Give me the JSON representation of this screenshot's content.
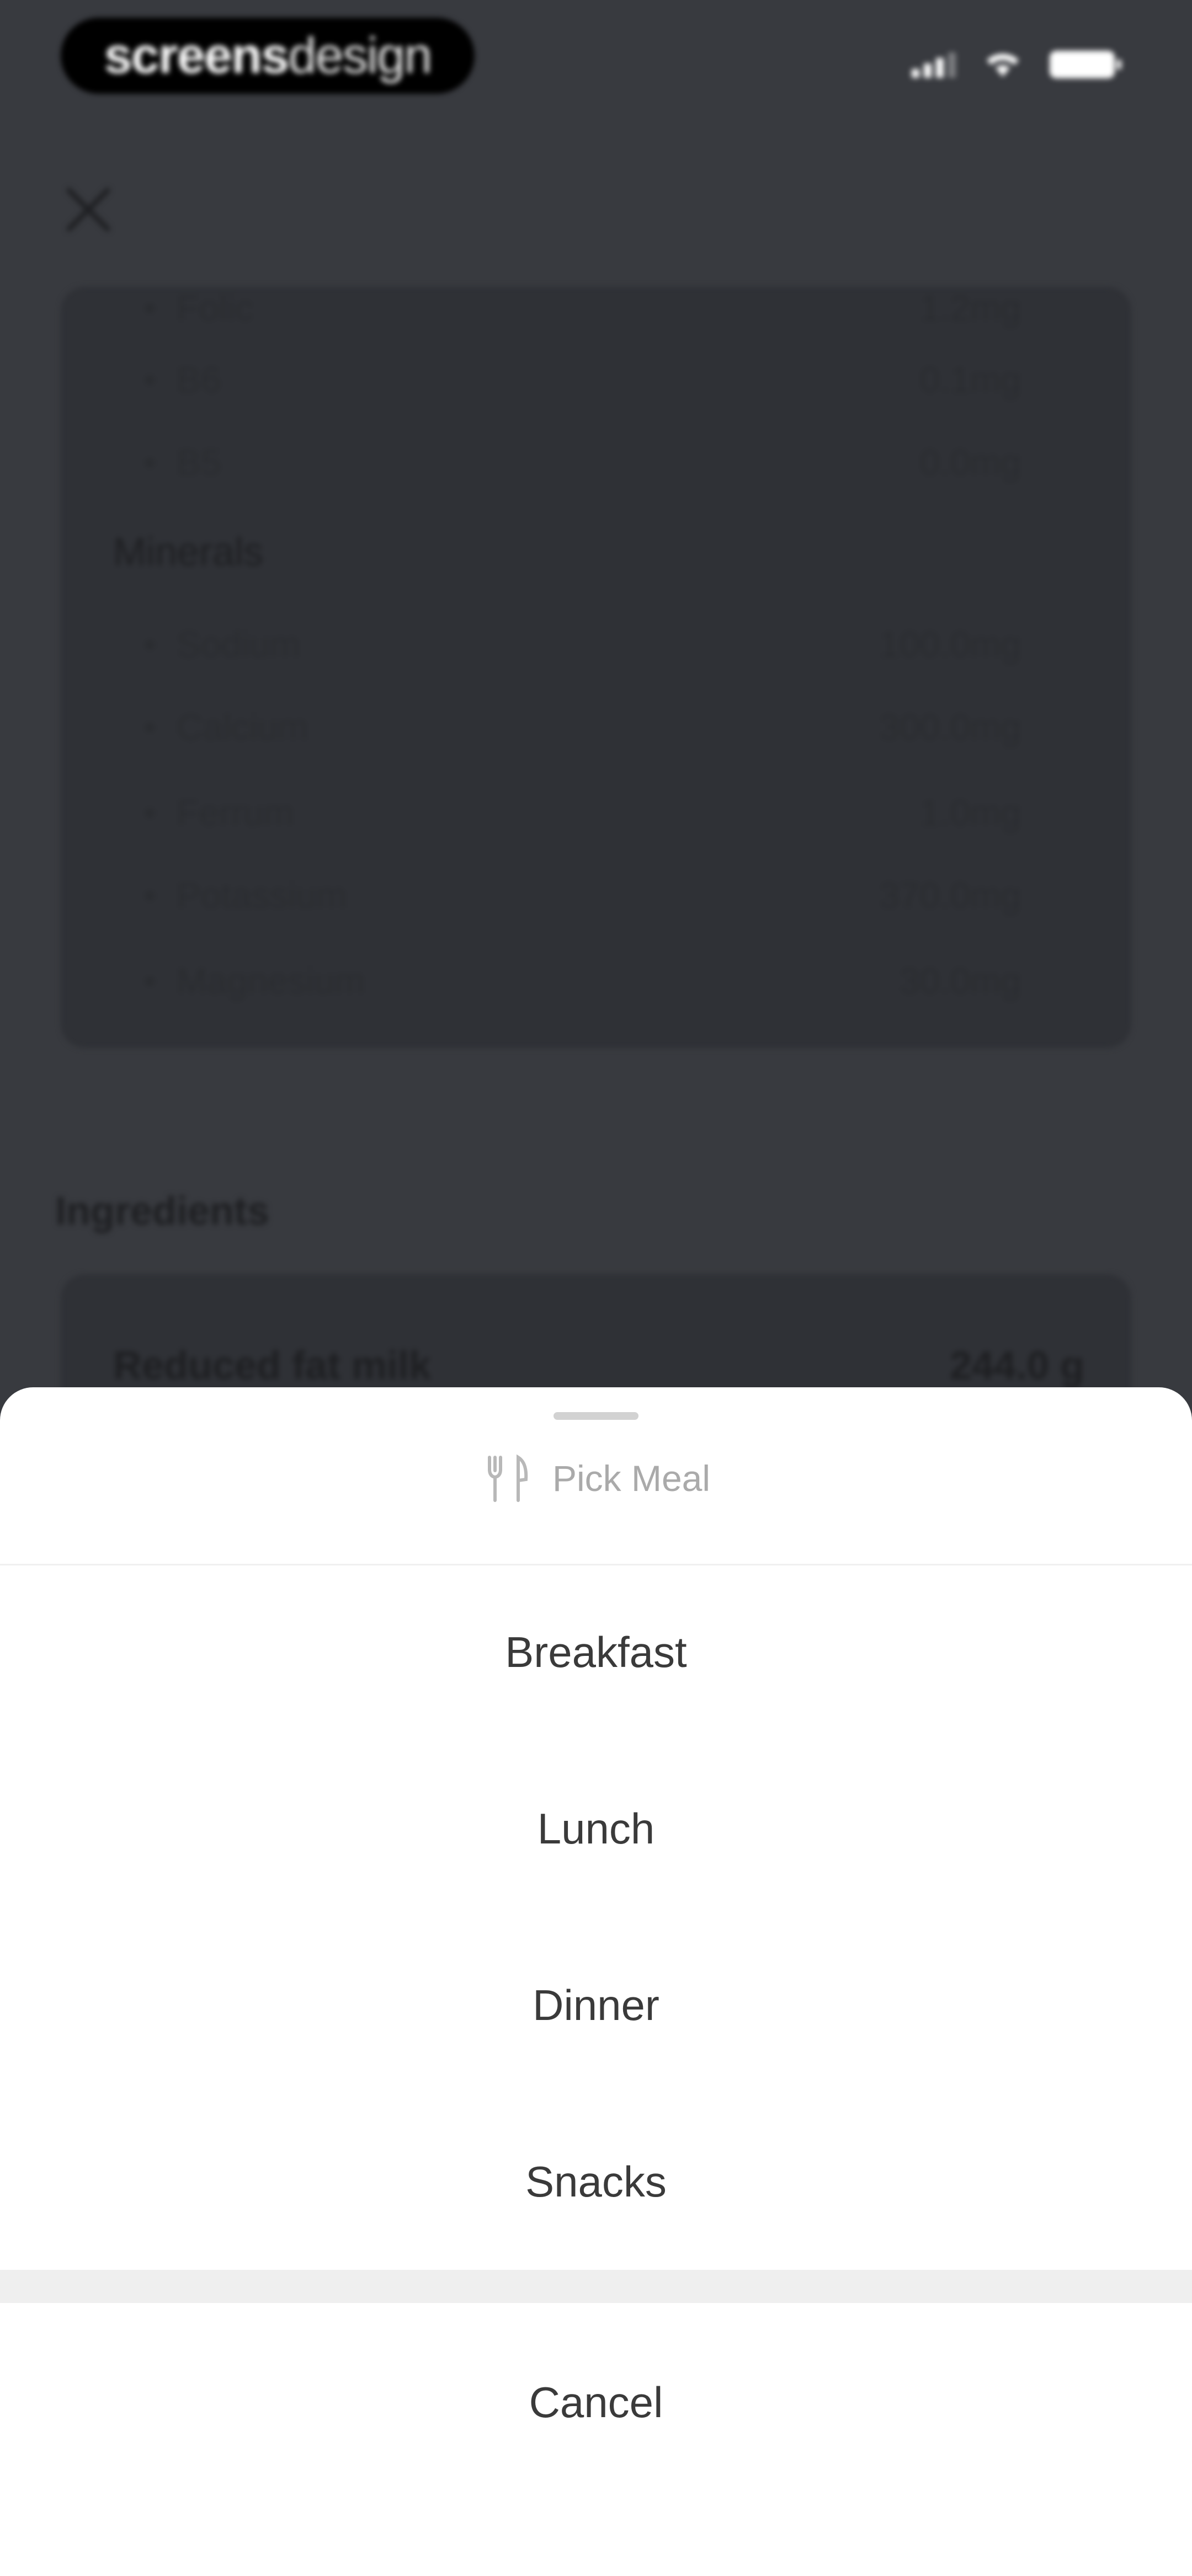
{
  "status_bar": {
    "brand_bold": "screens",
    "brand_light": "design"
  },
  "background": {
    "vitamin_rows": [
      {
        "label": "Folic",
        "value": "1.2mg"
      },
      {
        "label": "B6",
        "value": "0.1mg"
      },
      {
        "label": "B5",
        "value": "0.0mg"
      }
    ],
    "minerals_title": "Minerals",
    "mineral_rows": [
      {
        "label": "Sodium",
        "value": "100.0mg"
      },
      {
        "label": "Calcium",
        "value": "300.0mg"
      },
      {
        "label": "Ferrum",
        "value": "1.0mg"
      },
      {
        "label": "Potassium",
        "value": "370.0mg"
      },
      {
        "label": "Magnesium",
        "value": "30.0mg"
      }
    ],
    "ingredients_title": "Ingredients",
    "ingredient": {
      "name": "Reduced fat milk",
      "amount": "244.0 g"
    }
  },
  "sheet": {
    "title": "Pick Meal",
    "options": [
      "Breakfast",
      "Lunch",
      "Dinner",
      "Snacks"
    ],
    "cancel_label": "Cancel"
  },
  "colors": {
    "overlay": "#383a3f",
    "sheet_bg": "#ffffff",
    "option_text": "#3a3a3a",
    "header_text": "#aaaaaa"
  },
  "icons": {
    "close": "close-icon",
    "meal": "fork-knife-icon"
  }
}
